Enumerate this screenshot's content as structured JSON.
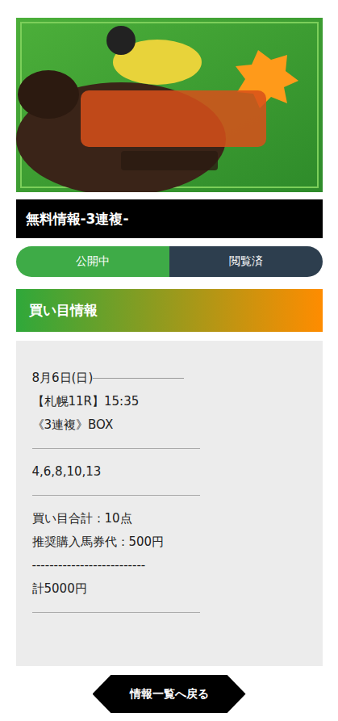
{
  "page_title": "無料情報-3連複-",
  "status_pills": [
    {
      "label": "公開中",
      "color": "#3eab47"
    },
    {
      "label": "閲覧済",
      "color": "#2d3e4e"
    }
  ],
  "section_header": "買い目情報",
  "info": {
    "date": "8月6日(日)",
    "race": "【札幌11R】15:35",
    "bet_type": "《3連複》BOX",
    "horses": "4,6,8,10,13",
    "total_points": "買い目合計：10点",
    "recommended": "推奨購入馬券代：500円",
    "separator": "--------------------------",
    "total": "計5000円"
  },
  "back_button": "情報一覧へ戻る"
}
